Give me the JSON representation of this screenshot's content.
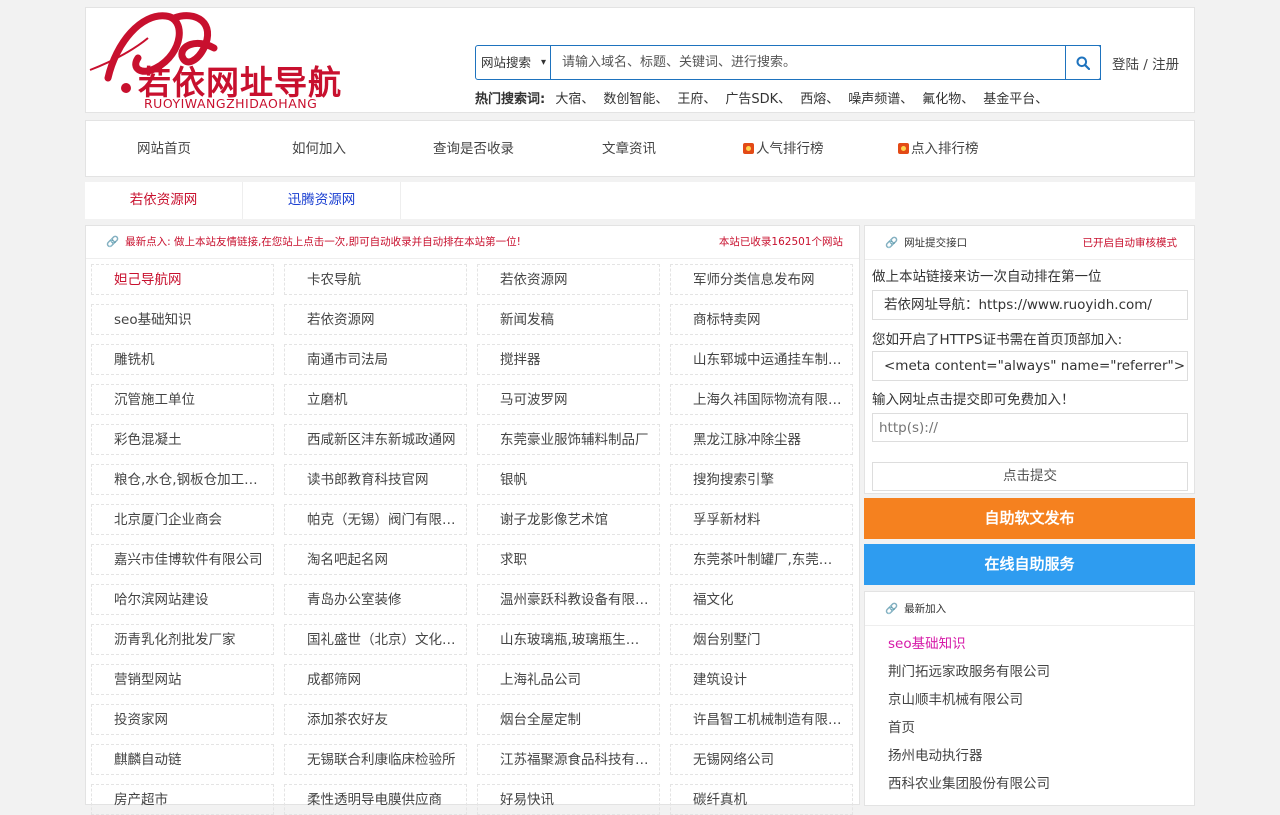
{
  "logo": {
    "text": "若依网址导航",
    "sub": "RUOYIWANGZHIDAOHANG"
  },
  "search": {
    "select_value": "网站搜索",
    "placeholder": "请输入域名、标题、关键词、进行搜索。"
  },
  "auth": {
    "login": "登陆",
    "sep": "/",
    "register": "注册"
  },
  "hot": {
    "label": "热门搜索词:",
    "keywords": [
      "大宿、",
      "数创智能、",
      "王府、",
      "广告SDK、",
      "西熔、",
      "噪声频谱、",
      "氟化物、",
      "基金平台、"
    ]
  },
  "nav": [
    "网站首页",
    "如何加入",
    "查询是否收录",
    "文章资讯",
    "人气排行榜",
    "点入排行榜"
  ],
  "subtabs": [
    {
      "label": "若依资源网",
      "color": "#c8102e"
    },
    {
      "label": "迅腾资源网",
      "color": "#1a3fd1"
    }
  ],
  "main": {
    "notice": "最新点入: 做上本站友情链接,在您站上点击一次,即可自动收录并自动排在本站第一位!",
    "count": "本站已收录162501个网站",
    "sites": [
      "妲己导航网",
      "卡农导航",
      "若依资源网",
      "军师分类信息发布网",
      "seo基础知识",
      "若依资源网",
      "新闻发稿",
      "商标特卖网",
      "雕铣机",
      "南通市司法局",
      "搅拌器",
      "山东郓城中运通挂车制造有限公司",
      "沉管施工单位",
      "立磨机",
      "马可波罗网",
      "上海久祎国际物流有限公司",
      "彩色混凝土",
      "西咸新区沣东新城政通网",
      "东莞豪业服饰辅料制品厂",
      "黑龙江脉冲除尘器",
      "粮仓,水仓,钢板仓加工厂家",
      "读书郎教育科技官网",
      "银帆",
      "搜狗搜索引擎",
      "北京厦门企业商会",
      "帕克（无锡）阀门有限公司",
      "谢子龙影像艺术馆",
      "孚孚新材料",
      "嘉兴市佳博软件有限公司",
      "淘名吧起名网",
      "求职",
      "东莞茶叶制罐厂,东莞礼品盒",
      "哈尔滨网站建设",
      "青岛办公室装修",
      "温州豪跃科教设备有限公司",
      "福文化",
      "沥青乳化剂批发厂家",
      "国礼盛世（北京）文化传播",
      "山东玻璃瓶,玻璃瓶生产厂家",
      "烟台别墅门",
      "营销型网站",
      "成都筛网",
      "上海礼品公司",
      "建筑设计",
      "投资家网",
      "添加茶农好友",
      "烟台全屋定制",
      "许昌智工机械制造有限公司",
      "麒麟自动链",
      "无锡联合利康临床检验所",
      "江苏福聚源食品科技有限公司",
      "无锡网络公司",
      "房产超市",
      "柔性透明导电膜供应商",
      "好易快讯",
      "碳纤真机"
    ],
    "first_color": "#c8102e"
  },
  "submit": {
    "title": "网址提交接口",
    "mode": "已开启自动审核模式",
    "line1": "做上本站链接来访一次自动排在第一位",
    "code1": "若依网址导航：https://www.ruoyidh.com/",
    "line2": "您如开启了HTTPS证书需在首页顶部加入:",
    "code2": "<meta content=\"always\" name=\"referrer\">",
    "line3": "输入网址点击提交即可免费加入！",
    "input_placeholder": "http(s)://",
    "button": "点击提交"
  },
  "buttons": {
    "publish": "自助软文发布",
    "service": "在线自助服务",
    "publish_color": "#f5811f",
    "service_color": "#2e9cf0"
  },
  "latest": {
    "title": "最新加入",
    "items": [
      "seo基础知识",
      "荆门拓远家政服务有限公司",
      "京山顺丰机械有限公司",
      "首页",
      "扬州电动执行器",
      "西科农业集团股份有限公司"
    ],
    "highlight_color": "#d61aa8"
  }
}
